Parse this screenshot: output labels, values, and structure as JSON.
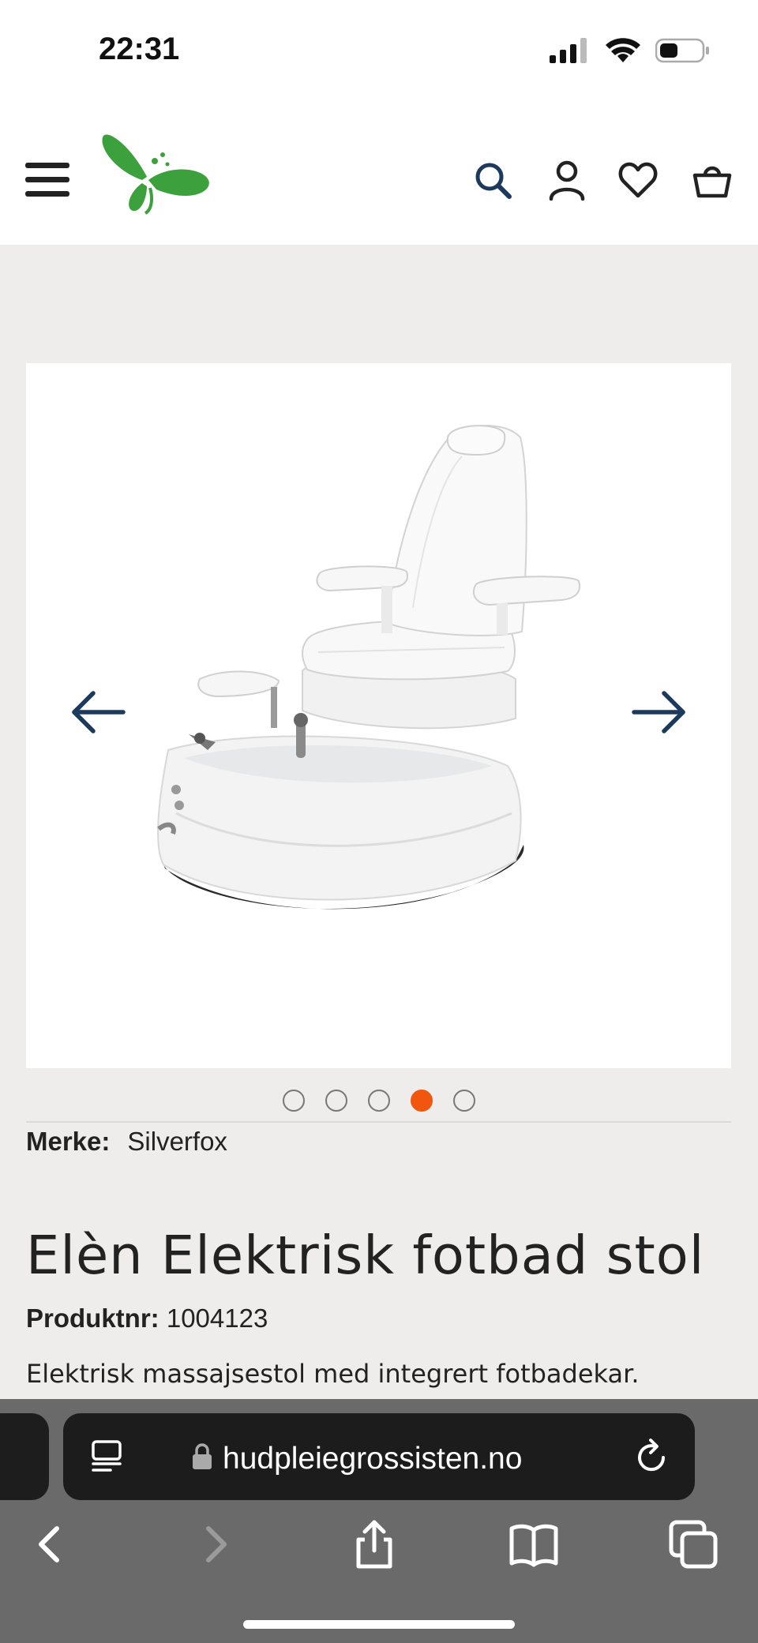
{
  "status_bar": {
    "time": "22:31"
  },
  "header": {
    "icons": [
      "menu-icon",
      "search-icon",
      "account-icon",
      "wishlist-icon",
      "cart-icon"
    ]
  },
  "gallery": {
    "slide_count": 5,
    "active_slide_index": 3
  },
  "product": {
    "brand_label": "Merke:",
    "brand_value": "Silverfox",
    "title": "Elèn Elektrisk fotbad stol",
    "product_number_label": "Produktnr:",
    "product_number_value": "1004123",
    "description": "Elektrisk massajsestol med integrert fotbadekar."
  },
  "browser": {
    "url": "hudpleiegrossisten.no"
  },
  "colors": {
    "accent": "#f0560e",
    "icon_blue": "#1c3a5e",
    "logo_green": "#3ca03c"
  }
}
